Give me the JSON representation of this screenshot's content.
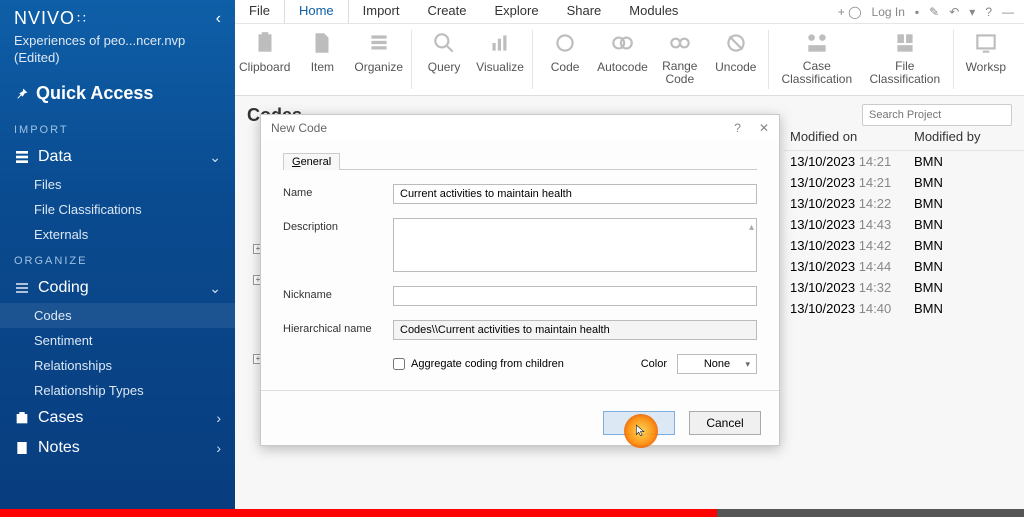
{
  "app": {
    "name": "NVIVO",
    "collapse_glyph": "‹"
  },
  "project": {
    "line1": "Experiences of peo...ncer.nvp",
    "line2": "(Edited)"
  },
  "quick_access": {
    "label": "Quick Access"
  },
  "section_import": "IMPORT",
  "section_organize": "ORGANIZE",
  "groups": {
    "data": {
      "label": "Data",
      "items": [
        "Files",
        "File Classifications",
        "Externals"
      ]
    },
    "coding": {
      "label": "Coding",
      "items": [
        "Codes",
        "Sentiment",
        "Relationships",
        "Relationship Types"
      ]
    },
    "cases": {
      "label": "Cases"
    },
    "notes": {
      "label": "Notes"
    }
  },
  "menu": {
    "items": [
      "File",
      "Home",
      "Import",
      "Create",
      "Explore",
      "Share",
      "Modules"
    ],
    "active": "Home",
    "right": {
      "login": "Log In"
    }
  },
  "ribbon": {
    "buttons": [
      {
        "label": "Clipboard"
      },
      {
        "label": "Item"
      },
      {
        "label": "Organize"
      },
      {
        "label": "Query"
      },
      {
        "label": "Visualize"
      },
      {
        "label": "Code"
      },
      {
        "label": "Autocode"
      },
      {
        "label": "Range Code",
        "two": true
      },
      {
        "label": "Uncode"
      },
      {
        "label": "Case Classification",
        "two": true
      },
      {
        "label": "File Classification",
        "two": true
      },
      {
        "label": "Workspace",
        "cut": "Worksp"
      }
    ]
  },
  "content": {
    "title": "Codes",
    "search_placeholder": "Search Project"
  },
  "dialog": {
    "title": "New Code",
    "tab": "General",
    "labels": {
      "name": "Name",
      "description": "Description",
      "nickname": "Nickname",
      "hier": "Hierarchical name",
      "agg": "Aggregate coding from children",
      "color": "Color"
    },
    "values": {
      "name": "Current activities to maintain health",
      "description": "",
      "nickname": "",
      "hier": "Codes\\\\Current activities to maintain health",
      "color": "None",
      "agg": false
    },
    "buttons": {
      "ok": "OK",
      "cancel": "Cancel"
    }
  },
  "grid": {
    "headers": {
      "modified_on": "Modified on",
      "modified_by": "Modified by"
    },
    "rows": [
      {
        "on": "13/10/2023 14:21",
        "by": "BMN"
      },
      {
        "on": "13/10/2023 14:21",
        "by": "BMN"
      },
      {
        "on": "13/10/2023 14:22",
        "by": "BMN"
      },
      {
        "on": "13/10/2023 14:43",
        "by": "BMN"
      },
      {
        "on": "13/10/2023 14:42",
        "by": "BMN"
      },
      {
        "on": "13/10/2023 14:44",
        "by": "BMN"
      },
      {
        "on": "13/10/2023 14:32",
        "by": "BMN"
      },
      {
        "on": "13/10/2023 14:40",
        "by": "BMN"
      }
    ]
  }
}
